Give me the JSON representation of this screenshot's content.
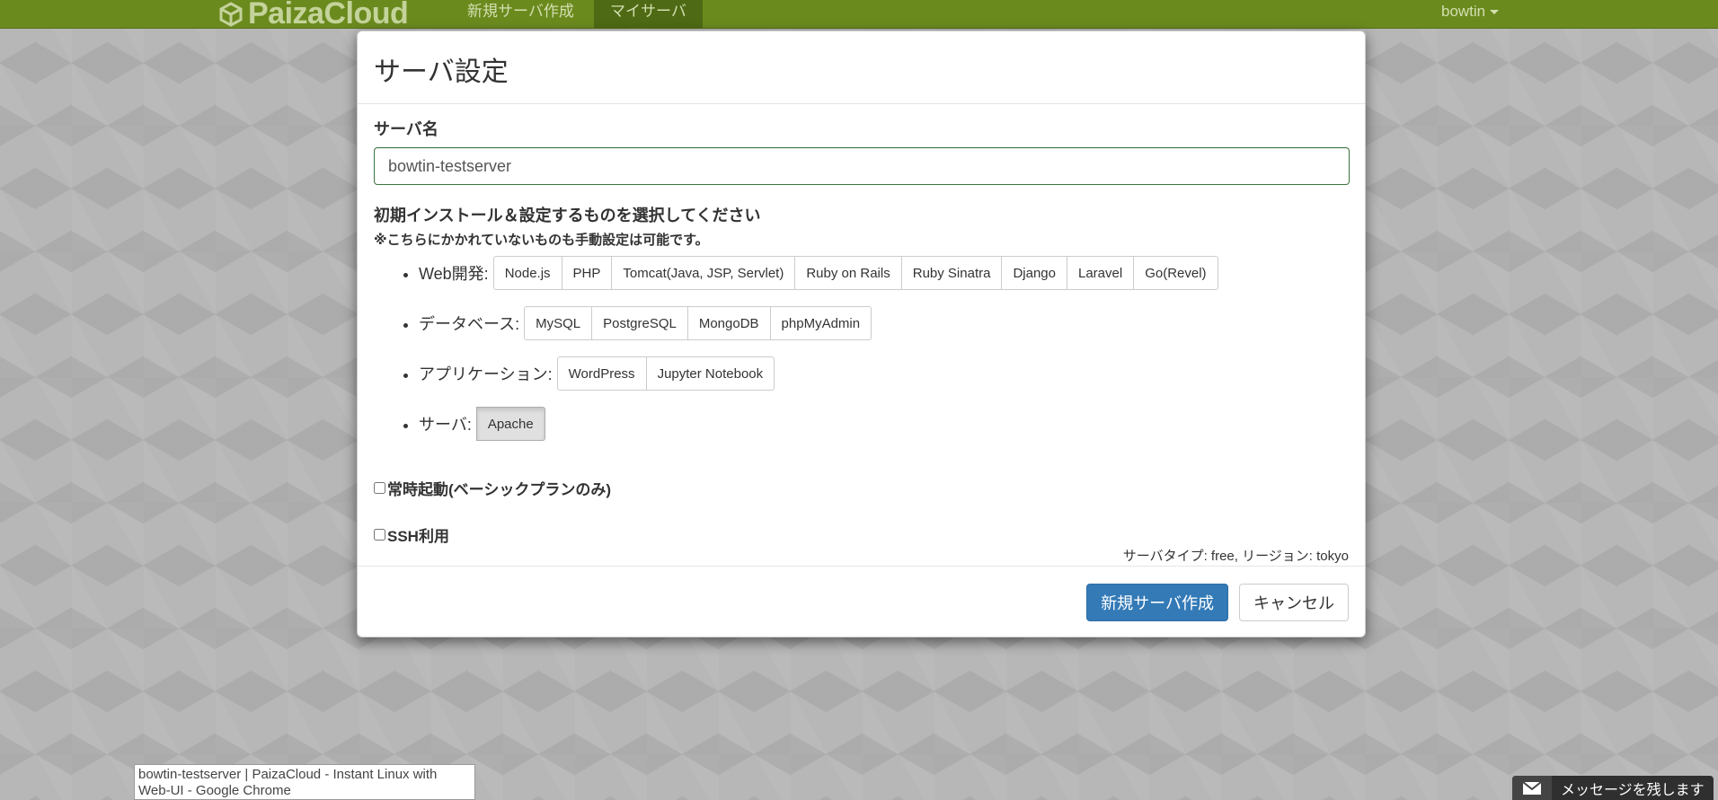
{
  "navbar": {
    "brand": "PaizaCloud",
    "links": [
      {
        "label": "新規サーバ作成"
      },
      {
        "label": "マイサーバ"
      }
    ],
    "user": "bowtin"
  },
  "modal": {
    "title": "サーバ設定",
    "server_name_label": "サーバ名",
    "server_name_value": "bowtin-testserver",
    "install_heading": "初期インストール＆設定するものを選択してください",
    "install_note": "※こちらにかかれていないものも手動設定は可能です。",
    "categories": [
      {
        "label": "Web開発:",
        "options": [
          "Node.js",
          "PHP",
          "Tomcat(Java, JSP, Servlet)",
          "Ruby on Rails",
          "Ruby Sinatra",
          "Django",
          "Laravel",
          "Go(Revel)"
        ]
      },
      {
        "label": "データベース:",
        "options": [
          "MySQL",
          "PostgreSQL",
          "MongoDB",
          "phpMyAdmin"
        ]
      },
      {
        "label": "アプリケーション:",
        "options": [
          "WordPress",
          "Jupyter Notebook"
        ]
      },
      {
        "label": "サーバ:",
        "options": [
          "Apache"
        ]
      }
    ],
    "always_on_label": "常時起動(ベーシックプランのみ)",
    "ssh_label": "SSH利用",
    "server_type": "サーバタイプ: free, リージョン: tokyo",
    "create_button": "新規サーバ作成",
    "cancel_button": "キャンセル"
  },
  "tooltip": "bowtin-testserver | PaizaCloud - Instant Linux with Web-UI - Google Chrome",
  "message_bar": {
    "icon": "mail-icon",
    "label": "メッセージを残します"
  }
}
